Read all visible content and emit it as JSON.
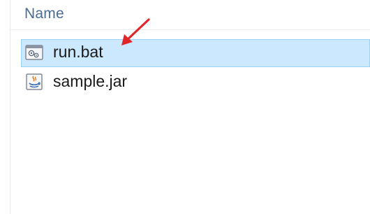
{
  "header": {
    "name_column": "Name"
  },
  "files": [
    {
      "name": "run.bat",
      "icon": "batch-file-icon",
      "selected": true
    },
    {
      "name": "sample.jar",
      "icon": "java-jar-icon",
      "selected": false
    }
  ],
  "colors": {
    "selection_fill": "#cce8ff",
    "selection_border": "#99d1ff",
    "header_text": "#4a6c95",
    "annotation_arrow": "#e0262b"
  }
}
